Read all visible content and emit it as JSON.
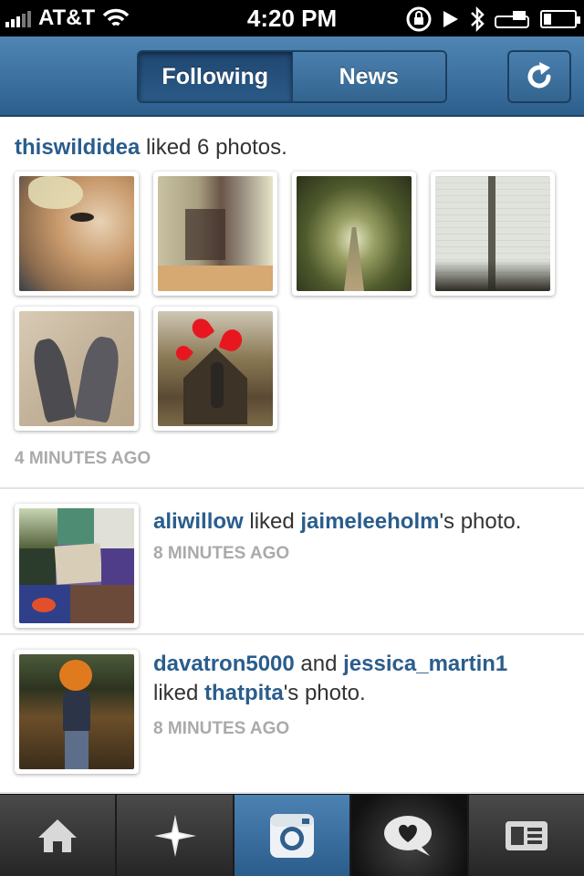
{
  "status_bar": {
    "carrier": "AT&T",
    "time": "4:20 PM",
    "battery_level": 0.25
  },
  "nav": {
    "tabs": [
      {
        "label": "Following",
        "active": true
      },
      {
        "label": "News",
        "active": false
      }
    ],
    "refresh_icon": "refresh-icon"
  },
  "feed": [
    {
      "user": "thiswildidea",
      "action": " liked 6 photos.",
      "time": "4 MINUTES AGO",
      "photos": [
        "dog",
        "closet-room",
        "tree-lined-path",
        "building-corner",
        "painted-hands",
        "hearts-tunnel"
      ]
    },
    {
      "user": "aliwillow",
      "action": " liked ",
      "target": "jaimeleeholm",
      "suffix": "'s photo.",
      "time": "8 MINUTES AGO",
      "photo": "collage"
    },
    {
      "user": "davatron5000",
      "connector": " and ",
      "user2": "jessica_martin1",
      "action": "liked ",
      "target": "thatpita",
      "suffix": "'s photo.",
      "time": "8 MINUTES AGO",
      "photo": "pumpkin-field"
    }
  ],
  "tab_bar": {
    "tabs": [
      "home-icon",
      "explore-star-icon",
      "camera-icon",
      "news-heart-bubble-icon",
      "profile-card-icon"
    ],
    "selected": "camera-icon"
  },
  "colors": {
    "link": "#2a5d8c",
    "nav_blue": "#3a6d9b",
    "timestamp": "#aaaaaa"
  }
}
